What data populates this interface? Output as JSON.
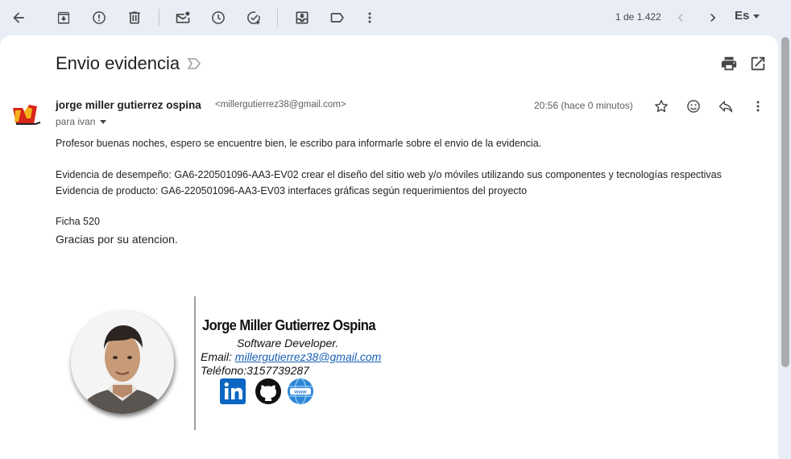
{
  "toolbar": {
    "pager_text": "1 de 1.422",
    "language": "Es"
  },
  "email": {
    "subject": "Envio evidencia",
    "sender_name": "jorge miller gutierrez ospina",
    "sender_email": "<millergutierrez38@gmail.com>",
    "to": "para ivan",
    "timestamp": "20:56 (hace 0 minutos)",
    "body": {
      "line1": "Profesor buenas noches, espero se encuentre bien, le escribo para informarle sobre el envio de la evidencia.",
      "line2": "Evidencia de desempeño: GA6-220501096-AA3-EV02 crear el diseño del sitio web y/o móviles utilizando sus componentes y tecnologías respectivas",
      "line3": "Evidencia de producto: GA6-220501096-AA3-EV03 interfaces gráficas según requerimientos del proyecto",
      "line4": "Ficha 520",
      "line5": "Gracias por su atencion."
    }
  },
  "signature": {
    "name": "Jorge Miller Gutierrez Ospina",
    "role": "Software Developer.",
    "email_label": "Email: ",
    "email_link": "millergutierrez38@gmail.com",
    "phone": "Teléfono:3157739287"
  },
  "colors": {
    "toolbar_bg": "#e9eef6",
    "panel_bg": "#ffffff",
    "linkedin": "#0a66c2",
    "link": "#1a5fb4"
  }
}
